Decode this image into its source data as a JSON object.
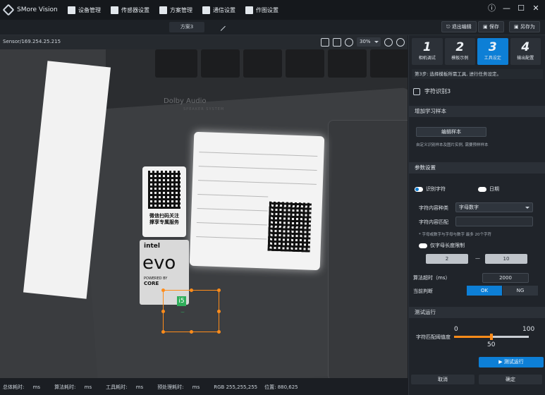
{
  "app": {
    "title": "SMore Vision"
  },
  "menu": [
    {
      "label": "设备管理",
      "icon": "house-icon"
    },
    {
      "label": "传感器设置",
      "icon": "grid-icon"
    },
    {
      "label": "方案管理",
      "icon": "grid-icon"
    },
    {
      "label": "通信设置",
      "icon": "upload-icon"
    },
    {
      "label": "作图设置",
      "icon": "image-icon"
    }
  ],
  "window": {
    "info": "ⓘ",
    "min": "—",
    "max": "☐",
    "close": "✕"
  },
  "subbar": {
    "scheme": "方案3",
    "exit_edit": "退出编辑",
    "save": "保存",
    "save_as": "另存为"
  },
  "viewer": {
    "sensor": "Sensor/169.254.25.215",
    "zoom": "30%"
  },
  "photo": {
    "dolby": "Dolby Audio",
    "speaker": "SPEAKER SYSTEM",
    "qr_caption_1": "微信扫码关注",
    "qr_caption_2": "撑享专属服务",
    "intel": "intel",
    "evo": "evo",
    "powered": "POWERED BY",
    "core": "CORE",
    "roi_char": "i5"
  },
  "status": {
    "total_time_label": "总体耗时:",
    "total_time_unit": "ms",
    "algo_time_label": "算法耗时:",
    "algo_time_unit": "ms",
    "tool_time_label": "工具耗时:",
    "tool_time_unit": "ms",
    "pre_time_label": "预处理耗时:",
    "pre_time_unit": "ms",
    "rgb": "RGB 255,255,255",
    "pos": "位置: 880,625"
  },
  "steps": [
    {
      "num": "1",
      "label": "相机调试"
    },
    {
      "num": "2",
      "label": "模板示例"
    },
    {
      "num": "3",
      "label": "工具设定"
    },
    {
      "num": "4",
      "label": "输出配置"
    }
  ],
  "step_note": "第3步: 选择模板所需工具, 进行任务设定。",
  "tool": {
    "name": "字符识别3"
  },
  "sections": {
    "learn": "增加学习样本",
    "params": "参数设置",
    "test": "测试运行"
  },
  "learn": {
    "edit_sample": "编辑样本",
    "note": "自定义识别样本及图片实例, 需要预样样本"
  },
  "params": {
    "radio_a": "识别字符",
    "radio_b": "日期",
    "char_type_label": "字符内容种类",
    "char_type_value": "字母数字",
    "char_match_label": "字符内容匹配",
    "char_note": "* 字母或数字与字母与数字 最多 20个字符",
    "length_label": "仅字母长度限制",
    "len_min": "2",
    "len_dash": "—",
    "len_max": "10",
    "timeout_label": "算法超时（ms）",
    "timeout_value": "2000",
    "output_label": "当前判断",
    "ok": "OK",
    "ng": "NG"
  },
  "test": {
    "threshold_label": "字符匹配阈值度",
    "min": "0",
    "max": "100",
    "value": 50,
    "value_text": "50",
    "run": "测试运行"
  },
  "footer": {
    "cancel": "取消",
    "confirm": "确定"
  },
  "colors": {
    "accent": "#0d7fd6",
    "roi": "#ff8c1a",
    "ok_bg": "#0d7fd6"
  }
}
